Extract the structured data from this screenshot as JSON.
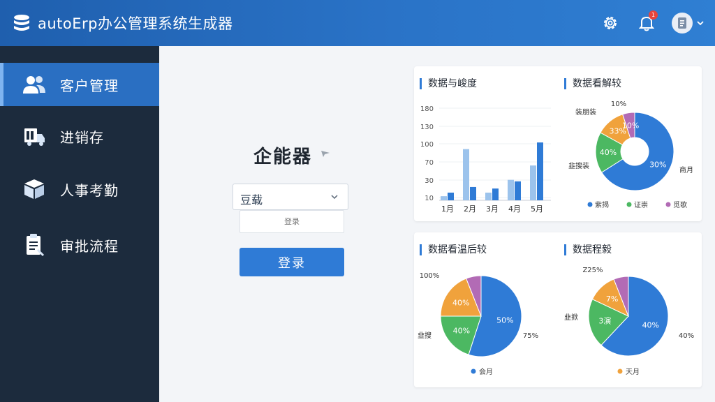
{
  "header": {
    "title": "autoErp办公管理系统生成器",
    "notification_count": "1",
    "icons": [
      "logo-icon",
      "gear-icon",
      "bell-icon",
      "avatar-icon",
      "chevron-down-icon"
    ]
  },
  "sidebar": {
    "items": [
      {
        "label": "客户管理",
        "icon": "users-icon",
        "active": true
      },
      {
        "label": "进销存",
        "icon": "truck-icon",
        "active": false
      },
      {
        "label": "人事考勤",
        "icon": "box-icon",
        "active": false
      },
      {
        "label": "审批流程",
        "icon": "clipboard-icon",
        "active": false
      }
    ]
  },
  "login": {
    "title": "企能器",
    "select_value": "豆载",
    "input_placeholder": "登录",
    "button_label": "登录"
  },
  "colors": {
    "accent": "#2f7bd6",
    "sidebar_bg": "#1c2b3d",
    "blue": "#2f7bd6",
    "light_blue": "#9cc3ec",
    "green": "#4cb862",
    "orange": "#f0a23c",
    "purple": "#b26bb5"
  },
  "chart_data": [
    {
      "type": "bar",
      "title": "数据与峻度",
      "categories": [
        "1月",
        "2月",
        "3月",
        "4月",
        "5月"
      ],
      "series": [
        {
          "values": [
            8,
            100,
            15,
            40,
            68
          ]
        },
        {
          "values": [
            15,
            26,
            23,
            37,
            113
          ]
        }
      ],
      "yticks": [
        "10",
        "30",
        "70",
        "100",
        "130",
        "180"
      ],
      "ylim": [
        0,
        180
      ]
    },
    {
      "type": "pie",
      "donut": true,
      "title": "数据看解较",
      "slices": [
        {
          "label": "30%",
          "value": 66,
          "color": "#2f7bd6"
        },
        {
          "label": "40%",
          "value": 17,
          "color": "#4cb862"
        },
        {
          "label": "33%",
          "value": 12,
          "color": "#f0a23c"
        },
        {
          "label": "10%",
          "value": 5,
          "color": "#b26bb5"
        }
      ],
      "outer_labels": [
        "10%",
        "装朋装",
        "韭搜装",
        "商月"
      ],
      "legend": [
        "紫揭",
        "证崇",
        "觅歌"
      ]
    },
    {
      "type": "pie",
      "title": "数据看温后较",
      "slices": [
        {
          "label": "50%",
          "value": 55,
          "color": "#2f7bd6"
        },
        {
          "label": "40%",
          "value": 20,
          "color": "#4cb862"
        },
        {
          "label": "40%",
          "value": 19,
          "color": "#f0a23c"
        },
        {
          "label": "",
          "value": 6,
          "color": "#b26bb5"
        }
      ],
      "outer_labels": [
        "100%",
        "韭搜",
        "75%"
      ],
      "legend": [
        "会月"
      ]
    },
    {
      "type": "pie",
      "title": "数据程毅",
      "slices": [
        {
          "label": "40%",
          "value": 62,
          "color": "#2f7bd6"
        },
        {
          "label": "3演",
          "value": 20,
          "color": "#4cb862"
        },
        {
          "label": "7%",
          "value": 12,
          "color": "#f0a23c"
        },
        {
          "label": "",
          "value": 6,
          "color": "#b26bb5"
        }
      ],
      "outer_labels": [
        "Z25%",
        "韭掀",
        "40%"
      ],
      "legend": [
        "天月"
      ]
    }
  ]
}
